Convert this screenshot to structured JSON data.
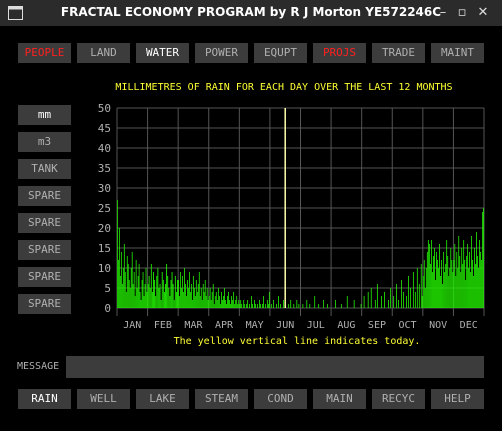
{
  "window": {
    "title": "FRACTAL ECONOMY PROGRAM by R J Morton YE572246C",
    "controls": [
      "–",
      "▫",
      "✕"
    ]
  },
  "top_tabs": [
    {
      "label": "PEOPLE",
      "state": "alert"
    },
    {
      "label": "LAND",
      "state": "normal"
    },
    {
      "label": "WATER",
      "state": "selected"
    },
    {
      "label": "POWER",
      "state": "normal"
    },
    {
      "label": "EQUPT",
      "state": "normal"
    },
    {
      "label": "PROJS",
      "state": "alert"
    },
    {
      "label": "TRADE",
      "state": "normal"
    },
    {
      "label": "MAINT",
      "state": "normal"
    }
  ],
  "side_buttons": [
    {
      "label": "mm",
      "state": "selected"
    },
    {
      "label": "m3",
      "state": "normal"
    },
    {
      "label": "TANK",
      "state": "normal"
    },
    {
      "label": "SPARE",
      "state": "normal"
    },
    {
      "label": "SPARE",
      "state": "normal"
    },
    {
      "label": "SPARE",
      "state": "normal"
    },
    {
      "label": "SPARE",
      "state": "normal"
    },
    {
      "label": "SPARE",
      "state": "normal"
    }
  ],
  "bottom_buttons": [
    {
      "label": "RAIN",
      "state": "selected"
    },
    {
      "label": "WELL",
      "state": "normal"
    },
    {
      "label": "LAKE",
      "state": "normal"
    },
    {
      "label": "STEAM",
      "state": "normal"
    },
    {
      "label": "COND",
      "state": "normal"
    },
    {
      "label": "MAIN",
      "state": "normal"
    },
    {
      "label": "RECYC",
      "state": "normal"
    },
    {
      "label": "HELP",
      "state": "normal"
    }
  ],
  "message": {
    "label": "MESSAGE",
    "value": ""
  },
  "note": "The yellow vertical line indicates today.",
  "colors": {
    "bar": "#22ee00",
    "today_line": "#ffffaa",
    "title": "#ffff33",
    "alert_text": "#ff2020",
    "button_bg": "#3c3c3c",
    "grid": "#555555"
  },
  "chart_data": {
    "type": "bar",
    "title": "MILLIMETRES OF RAIN FOR EACH DAY OVER THE LAST 12 MONTHS",
    "xlabel": "",
    "ylabel": "",
    "ylim": [
      0,
      50
    ],
    "yticks": [
      0,
      5,
      10,
      15,
      20,
      25,
      30,
      35,
      40,
      45,
      50
    ],
    "categories": [
      "JAN",
      "FEB",
      "MAR",
      "APR",
      "MAY",
      "JUN",
      "JUL",
      "AUG",
      "SEP",
      "OCT",
      "NOV",
      "DEC"
    ],
    "today_month_position": 5.5,
    "grid": true,
    "monthly_rain_mm": [
      [
        27,
        12,
        20,
        8,
        14,
        6,
        10,
        16,
        9,
        4,
        13,
        11,
        7,
        5,
        10,
        14,
        6,
        9,
        3,
        12,
        5,
        8,
        11,
        4,
        2,
        7,
        9,
        3,
        6,
        10,
        4
      ],
      [
        6,
        8,
        5,
        11,
        4,
        9,
        7,
        3,
        8,
        10,
        5,
        6,
        2,
        9,
        7,
        4,
        6,
        11,
        8,
        5,
        3,
        7,
        9,
        6,
        2,
        8,
        4,
        7
      ],
      [
        7,
        3,
        9,
        5,
        8,
        4,
        10,
        6,
        3,
        7,
        5,
        9,
        4,
        6,
        2,
        8,
        5,
        3,
        7,
        4,
        6,
        9,
        3,
        5,
        2,
        6,
        4,
        7,
        3,
        5,
        2
      ],
      [
        3,
        5,
        2,
        4,
        6,
        1,
        3,
        4,
        2,
        5,
        3,
        1,
        4,
        2,
        3,
        5,
        2,
        1,
        3,
        4,
        2,
        1,
        3,
        2,
        4,
        1,
        2,
        3,
        1,
        2
      ],
      [
        1,
        2,
        1,
        0,
        2,
        1,
        0,
        1,
        2,
        0,
        1,
        0,
        3,
        1,
        0,
        2,
        1,
        0,
        1,
        0,
        2,
        1,
        0,
        1,
        3,
        0,
        1,
        0,
        2,
        1,
        4
      ],
      [
        0,
        1,
        0,
        2,
        0,
        0,
        1,
        0,
        3,
        0,
        1,
        0,
        0,
        2,
        0,
        1,
        0,
        0,
        1,
        0,
        2,
        0,
        0,
        1,
        0,
        0,
        2,
        0,
        1,
        0
      ],
      [
        0,
        0,
        1,
        0,
        0,
        0,
        2,
        0,
        0,
        1,
        0,
        0,
        0,
        0,
        3,
        0,
        0,
        0,
        1,
        0,
        0,
        0,
        0,
        2,
        0,
        0,
        0,
        1,
        0,
        0,
        0
      ],
      [
        0,
        0,
        0,
        0,
        2,
        0,
        0,
        0,
        0,
        0,
        1,
        0,
        0,
        0,
        0,
        0,
        3,
        0,
        0,
        0,
        0,
        0,
        0,
        2,
        0,
        0,
        0,
        0,
        0,
        0,
        1
      ],
      [
        0,
        0,
        3,
        0,
        0,
        0,
        4,
        0,
        0,
        5,
        0,
        0,
        0,
        2,
        0,
        6,
        0,
        0,
        0,
        3,
        0,
        0,
        4,
        0,
        0,
        0,
        2,
        0,
        5,
        0
      ],
      [
        0,
        3,
        0,
        0,
        6,
        0,
        2,
        0,
        0,
        7,
        0,
        4,
        0,
        0,
        3,
        0,
        8,
        0,
        5,
        0,
        0,
        9,
        0,
        4,
        0,
        10,
        0,
        6,
        0,
        11,
        3
      ],
      [
        8,
        12,
        5,
        10,
        14,
        17,
        16,
        11,
        17,
        9,
        13,
        15,
        7,
        14,
        12,
        10,
        16,
        8,
        12,
        6,
        14,
        9,
        11,
        17,
        13,
        8,
        10,
        15,
        12,
        9
      ],
      [
        12,
        16,
        8,
        14,
        10,
        18,
        13,
        9,
        15,
        11,
        17,
        12,
        7,
        13,
        16,
        10,
        14,
        9,
        18,
        12,
        8,
        15,
        11,
        19,
        13,
        10,
        17,
        14,
        12,
        24,
        25
      ]
    ]
  }
}
